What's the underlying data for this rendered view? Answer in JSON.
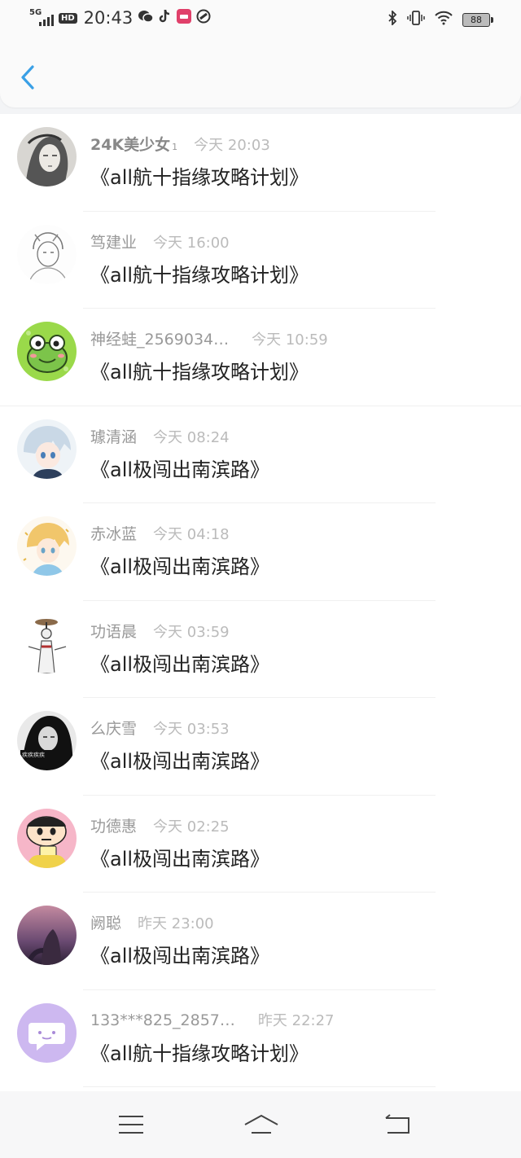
{
  "status_bar": {
    "network": "5G",
    "hd": "HD",
    "time": "20:43",
    "battery": "88",
    "icons": [
      "wechat-icon",
      "tiktok-icon",
      "app-icon",
      "link-icon",
      "bluetooth-icon",
      "vibrate-icon",
      "wifi-icon",
      "battery-icon"
    ]
  },
  "header": {
    "back_icon": "chevron-left-icon",
    "accent": "#3aa0e6"
  },
  "items": [
    {
      "name": "24K美少女",
      "sup": "1",
      "time": "今天 20:03",
      "title": "《all航十指缘攻略计划》",
      "avatar": "sketch-girl"
    },
    {
      "name": "笃建业",
      "time": "今天 16:00",
      "title": "《all航十指缘攻略计划》",
      "avatar": "sketch-boy"
    },
    {
      "name": "神经蛙_2569034…",
      "time": "今天 10:59",
      "title": "《all航十指缘攻略计划》",
      "avatar": "green-frog"
    },
    {
      "name": "璩清涵",
      "time": "今天 08:24",
      "title": "《all极闯出南滨路》",
      "avatar": "anime-white-hair"
    },
    {
      "name": "赤冰蓝",
      "time": "今天 04:18",
      "title": "《all极闯出南滨路》",
      "avatar": "anime-blonde"
    },
    {
      "name": "功语晨",
      "time": "今天 03:59",
      "title": "《all极闯出南滨路》",
      "avatar": "ink-figure"
    },
    {
      "name": "么庆雪",
      "time": "今天 03:53",
      "title": "《all极闯出南滨路》",
      "avatar": "bw-portrait"
    },
    {
      "name": "功德惠",
      "time": "今天 02:25",
      "title": "《all极闯出南滨路》",
      "avatar": "shinchan"
    },
    {
      "name": "阙聪",
      "time": "昨天 23:00",
      "title": "《all极闯出南滨路》",
      "avatar": "purple-night"
    },
    {
      "name": "133***825_2857…",
      "time": "昨天 22:27",
      "title": "《all航十指缘攻略计划》",
      "avatar": "default-chat"
    }
  ],
  "nav": [
    "menu-icon",
    "home-icon",
    "back-arrow-icon"
  ]
}
